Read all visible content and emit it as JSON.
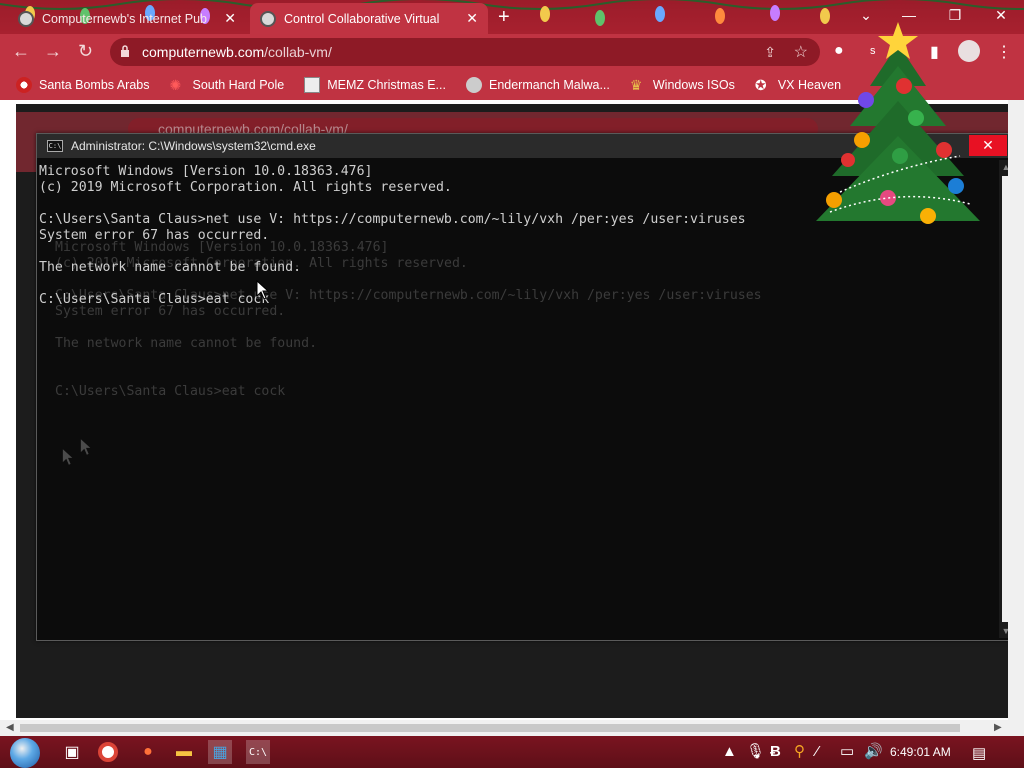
{
  "browser": {
    "tabs": [
      {
        "title": "Computernewb's Internet Pub",
        "active": false
      },
      {
        "title": "Control Collaborative Virtual",
        "active": true
      }
    ],
    "url_host": "computernewb.com",
    "url_path": "/collab-vm/",
    "profile_letter": "s",
    "bookmarks": [
      {
        "label": "Santa Bombs Arabs",
        "icon": "santa-icon"
      },
      {
        "label": "South Hard Pole",
        "icon": "pole-icon"
      },
      {
        "label": "MEMZ Christmas E...",
        "icon": "memz-icon"
      },
      {
        "label": "Endermanch Malwa...",
        "icon": "endermanch-icon"
      },
      {
        "label": "Windows ISOs",
        "icon": "windows-iso-icon"
      },
      {
        "label": "VX Heaven",
        "icon": "vx-heaven-icon"
      }
    ],
    "accent": "#c03342"
  },
  "ghost": {
    "url": "computernewb.com/collab-vm/",
    "lines": [
      "Microsoft Windows [Version 10.0.18363.476]",
      "(c) 2019 Microsoft Corporation. All rights reserved.",
      "",
      "C:\\Users\\Santa Claus>net use V: https://computernewb.com/~lily/vxh /per:yes /user:viruses",
      "System error 67 has occurred.",
      "",
      "The network name cannot be found.",
      "",
      "",
      "C:\\Users\\Santa Claus>eat cock"
    ]
  },
  "cmd": {
    "title": "Administrator: C:\\Windows\\system32\\cmd.exe",
    "icon_text": "C:\\",
    "lines": [
      "Microsoft Windows [Version 10.0.18363.476]",
      "(c) 2019 Microsoft Corporation. All rights reserved.",
      "",
      "C:\\Users\\Santa Claus>net use V: https://computernewb.com/~lily/vxh /per:yes /user:viruses",
      "System error 67 has occurred.",
      "",
      "The network name cannot be found.",
      "",
      "C:\\Users\\Santa Claus>eat cock"
    ]
  },
  "taskbar": {
    "pinned": [
      "task-view-icon",
      "chrome-icon",
      "firefox-icon",
      "explorer-icon",
      "store-icon",
      "cmd-icon"
    ],
    "clock": "6:49:01 AM"
  }
}
